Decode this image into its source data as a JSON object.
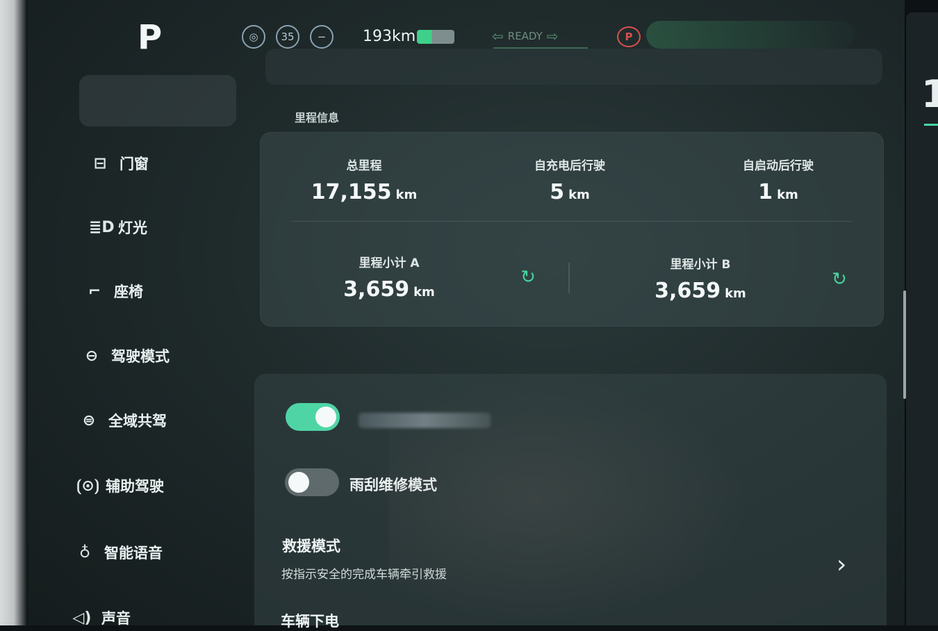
{
  "status_bar": {
    "gear": "P",
    "speed_limit": "35",
    "range": "193",
    "range_unit": "km",
    "ready": "READY",
    "brake_symbol": "P",
    "colors": {
      "accent": "#4fd5a5",
      "brake": "#d9504d"
    }
  },
  "sidebar": {
    "items": [
      {
        "label": "门窗",
        "icon": "door-icon"
      },
      {
        "label": "灯光",
        "icon": "headlight-icon"
      },
      {
        "label": "座椅",
        "icon": "seat-icon"
      },
      {
        "label": "驾驶模式",
        "icon": "steering-wheel-icon"
      },
      {
        "label": "全域共驾",
        "icon": "shared-drive-icon"
      },
      {
        "label": "辅助驾驶",
        "icon": "assist-drive-icon"
      },
      {
        "label": "智能语音",
        "icon": "microphone-icon"
      },
      {
        "label": "声音",
        "icon": "speaker-icon"
      }
    ]
  },
  "mileage": {
    "section_title": "里程信息",
    "total": {
      "label": "总里程",
      "value": "17,155",
      "unit": "km"
    },
    "since_charge": {
      "label": "自充电后行驶",
      "value": "5",
      "unit": "km"
    },
    "since_start": {
      "label": "自启动后行驶",
      "value": "1",
      "unit": "km"
    },
    "trip_a": {
      "label": "里程小计 A",
      "value": "3,659",
      "unit": "km"
    },
    "trip_b": {
      "label": "里程小计 B",
      "value": "3,659",
      "unit": "km"
    }
  },
  "settings": {
    "toggle1_on": true,
    "wiper": {
      "label": "雨刮维修模式",
      "on": false
    },
    "rescue": {
      "title": "救援模式",
      "subtitle": "按指示安全的完成车辆牵引救援"
    },
    "power_off": {
      "title": "车辆下电"
    }
  }
}
